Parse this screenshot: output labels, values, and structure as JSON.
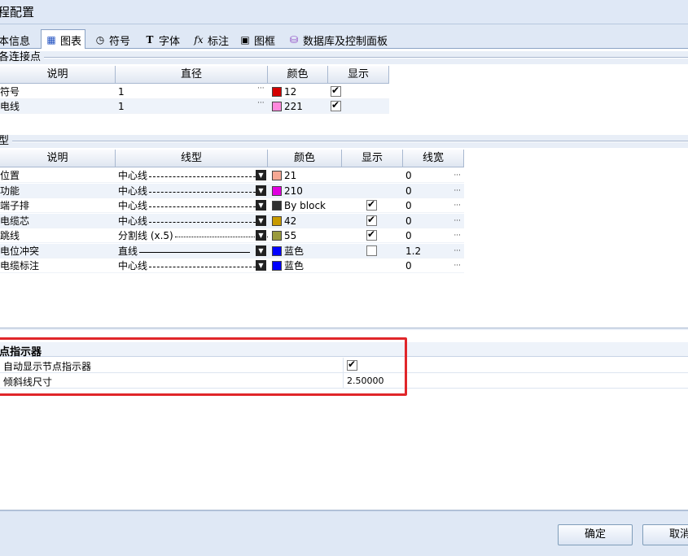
{
  "window": {
    "title": "程配置"
  },
  "tabs": [
    {
      "label": "本信息",
      "icon": "info-icon"
    },
    {
      "label": "图表",
      "icon": "chart-grid-icon",
      "active": true
    },
    {
      "label": "符号",
      "icon": "symbol-icon"
    },
    {
      "label": "字体",
      "icon": "font-icon"
    },
    {
      "label": "标注",
      "icon": "fx-icon"
    },
    {
      "label": "图框",
      "icon": "frame-icon"
    },
    {
      "label": "数据库及控制面板",
      "icon": "database-icon"
    }
  ],
  "connection": {
    "section_title": "各连接点",
    "headers": [
      "说明",
      "直径",
      "颜色",
      "显示"
    ],
    "rows": [
      {
        "desc": "符号",
        "diameter": "1",
        "color_hex": "#d40000",
        "color_label": "12",
        "show": true
      },
      {
        "desc": "电线",
        "diameter": "1",
        "color_hex": "#ff88dd",
        "color_label": "221",
        "show": true
      }
    ]
  },
  "lines": {
    "section_title": "型",
    "headers": [
      "说明",
      "线型",
      "颜色",
      "显示",
      "线宽"
    ],
    "rows": [
      {
        "desc": "位置",
        "linetype": "中心线",
        "pattern": "dash",
        "color_hex": "#f6a894",
        "color_label": "21",
        "show": null,
        "width": "0"
      },
      {
        "desc": "功能",
        "linetype": "中心线",
        "pattern": "dash",
        "color_hex": "#e000e0",
        "color_label": "210",
        "show": null,
        "width": "0"
      },
      {
        "desc": "端子排",
        "linetype": "中心线",
        "pattern": "dash",
        "color_hex": "#303030",
        "color_label": "By block",
        "show": true,
        "width": "0"
      },
      {
        "desc": "电缆芯",
        "linetype": "中心线",
        "pattern": "dash",
        "color_hex": "#c89a00",
        "color_label": "42",
        "show": true,
        "width": "0"
      },
      {
        "desc": "跳线",
        "linetype": "分割线 (x.5)",
        "pattern": "dashdot",
        "color_hex": "#9a9a3c",
        "color_label": "55",
        "show": true,
        "width": "0"
      },
      {
        "desc": "电位冲突",
        "linetype": "直线",
        "pattern": "solid",
        "color_hex": "#0000ff",
        "color_label": "蓝色",
        "show": false,
        "width": "1.2"
      },
      {
        "desc": "电缆标注",
        "linetype": "中心线",
        "pattern": "dash",
        "color_hex": "#0000ff",
        "color_label": "蓝色",
        "show": null,
        "width": "0"
      }
    ]
  },
  "node_indicator": {
    "title": "点指示器",
    "rows": [
      {
        "label": "自动显示节点指示器",
        "value": "",
        "checkbox": true
      },
      {
        "label": "倾斜线尺寸",
        "value": "2.50000",
        "checkbox": false
      }
    ]
  },
  "buttons": {
    "ok": "确定",
    "cancel": "取消"
  }
}
